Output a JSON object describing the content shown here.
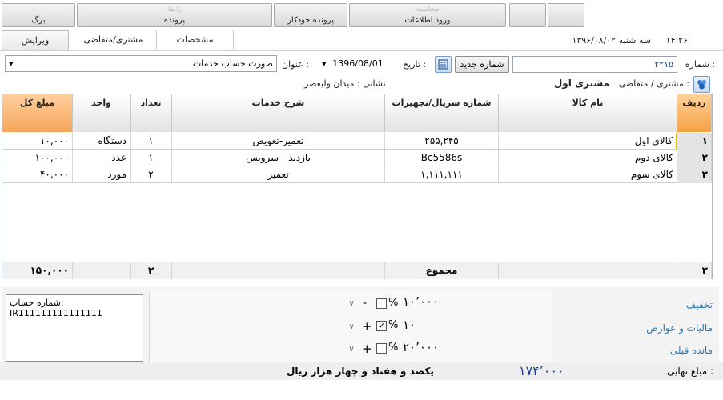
{
  "toolbar": {
    "btn_receipt": "برگ",
    "btn_file": "پرونده",
    "btn_auto_file": "پرونده خودکار",
    "btn_import": "ورود اطلاعات",
    "faint_1": "رابط",
    "faint_2": "محاسبه"
  },
  "tabs": [
    {
      "label": "ویرایش"
    },
    {
      "label": "مشتری/متقاضی"
    },
    {
      "label": "مشخصات"
    }
  ],
  "header": {
    "datetime": "سه شنبه ۱۳۹۶/۰۸/۰۲",
    "time": "۱۴:۲۶"
  },
  "form": {
    "number_label": "شماره :",
    "number_value": "۲۲۱۵",
    "new_number_button": "شماره جدید",
    "date_label": "تاریخ :",
    "date_value": "1396/08/01",
    "title_label": "عنوان :",
    "title_value": "صورت حساب خدمات",
    "customer_label": "مشتری / متقاضی :",
    "customer_value": "مشتری اول",
    "address": "نشانی : میدان ولیعصر"
  },
  "grid": {
    "headers": {
      "row": "ردیف",
      "item": "نام کالا",
      "serial": "شماره سریال/تجهیزات",
      "desc": "شرح خدمات",
      "qty": "تعداد",
      "unit": "واحد",
      "total": "مبلغ کل"
    },
    "rows": [
      {
        "row": "۱",
        "item": "کالای اول",
        "serial": "۲۵۵,۲۴۵",
        "desc": "تعمیر-تعویض",
        "qty": "۱",
        "unit": "دستگاه",
        "total": "۱۰,۰۰۰"
      },
      {
        "row": "۲",
        "item": "کالای دوم",
        "serial": "Bc5586s",
        "desc": "بازدید - سرویس",
        "qty": "۱",
        "unit": "عدد",
        "total": "۱۰۰,۰۰۰"
      },
      {
        "row": "۳",
        "item": "کالای سوم",
        "serial": "۱,۱۱۱,۱۱۱",
        "desc": "تعمیر",
        "qty": "۲",
        "unit": "مورد",
        "total": "۴۰,۰۰۰"
      }
    ],
    "summary": {
      "row": "۳",
      "label": "مجموع",
      "qty": "۲",
      "total": "۱۵۰,۰۰۰"
    }
  },
  "adjustments": {
    "discount_label": "تخفیف",
    "discount_value": "۱۰٬۰۰۰",
    "discount_sign": "-",
    "tax_label": "مالیات و عوارض",
    "tax_value": "۱۰",
    "tax_sign": "+",
    "prev_label": "مانده قبلی",
    "prev_value": "۲۰٬۰۰۰",
    "prev_sign": "+",
    "percent": "%",
    "check_mark": "✓"
  },
  "account": {
    "label": "شماره حساب:",
    "value": "IR111111111111111"
  },
  "final": {
    "label": "مبلغ نهایی :",
    "value": "۱۷۴٬۰۰۰",
    "words": "یکصد و هفتاد و چهار هزار  ریال"
  }
}
